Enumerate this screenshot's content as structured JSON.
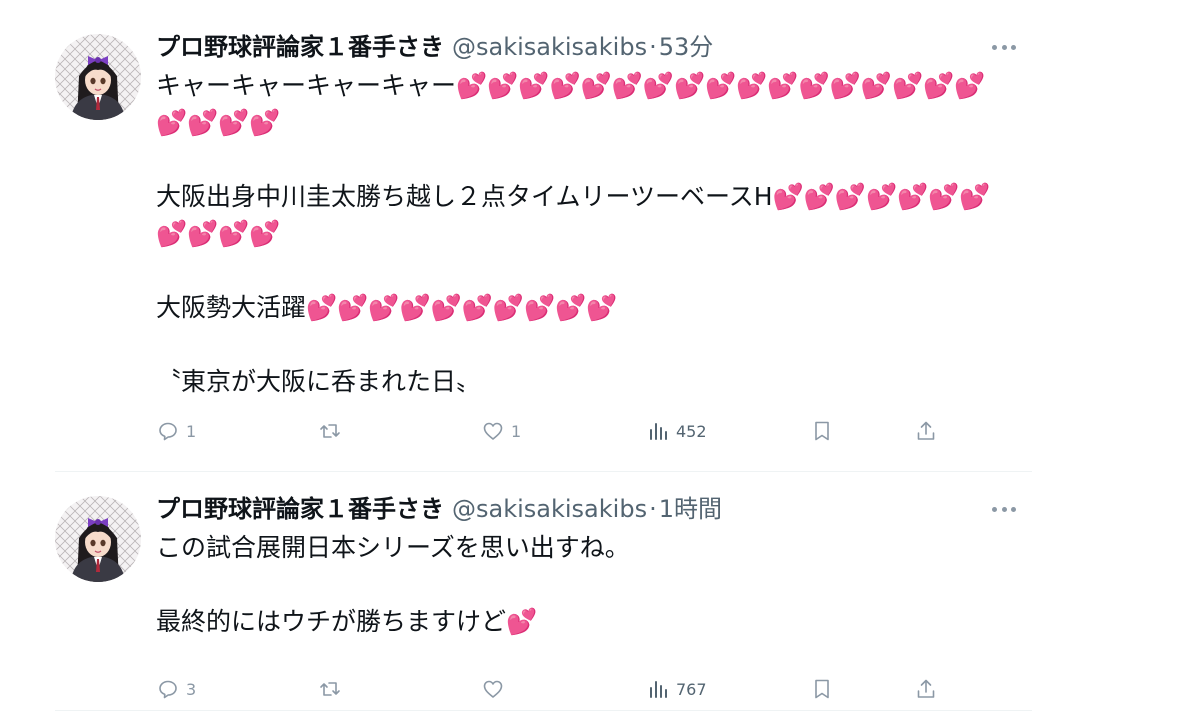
{
  "tweets": [
    {
      "author": {
        "display_name": "プロ野球評論家１番手さき",
        "handle": "@sakisakisakibs"
      },
      "separator": "·",
      "time": "53分",
      "paragraphs": [
        "キャーキャーキャーキャー💕💕💕💕💕💕💕💕💕💕💕💕💕💕💕💕💕💕💕💕💕",
        "大阪出身中川圭太勝ち越し２点タイムリーツーベースH💕💕💕💕💕💕💕💕💕💕💕",
        "大阪勢大活躍💕💕💕💕💕💕💕💕💕💕",
        "〝東京が大阪に呑まれた日〟"
      ],
      "stats": {
        "replies": "1",
        "retweets": "",
        "likes": "1",
        "views": "452"
      }
    },
    {
      "author": {
        "display_name": "プロ野球評論家１番手さき",
        "handle": "@sakisakisakibs"
      },
      "separator": "·",
      "time": "1時間",
      "paragraphs": [
        "この試合展開日本シリーズを思い出すね。",
        "最終的にはウチが勝ちますけど💕"
      ],
      "stats": {
        "replies": "3",
        "retweets": "",
        "likes": "",
        "views": "767"
      }
    }
  ],
  "icons": {
    "reply": "reply-icon",
    "retweet": "retweet-icon",
    "like": "heart-icon",
    "views": "views-chart-icon",
    "bookmark": "bookmark-icon",
    "share": "share-icon",
    "more": "more-icon"
  },
  "colors": {
    "text": "#0f1419",
    "secondary": "#536471",
    "icon": "#8b98a5",
    "divider": "#eff3f4",
    "heart_emoji": "#e6459c",
    "avatar_bow": "#7b3fc2"
  }
}
